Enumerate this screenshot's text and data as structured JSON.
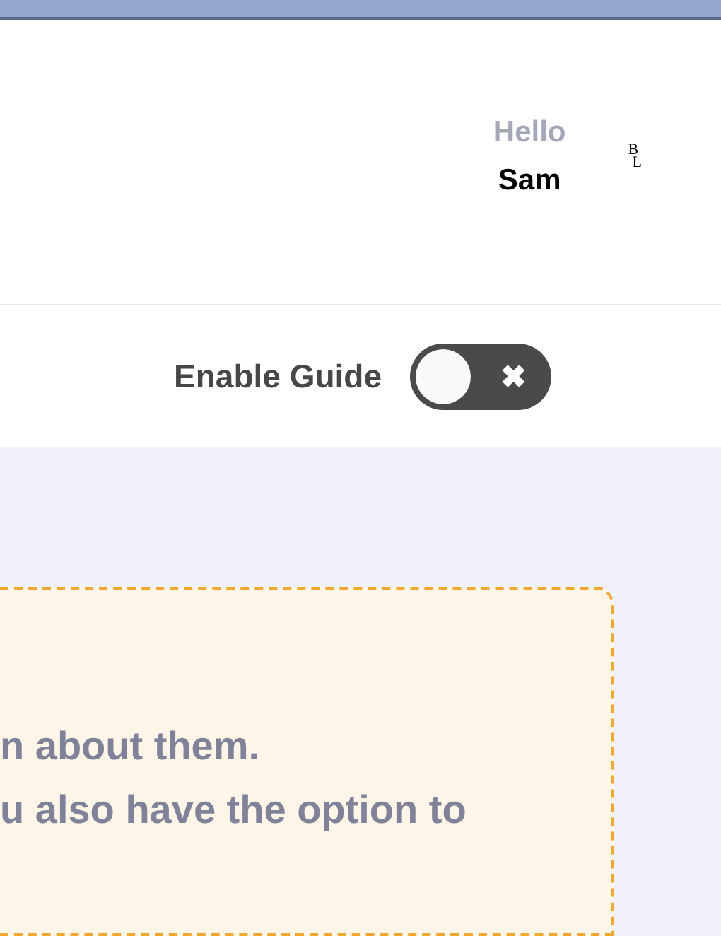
{
  "header": {
    "greeting": "Hello",
    "user_name": "Sam",
    "logo_letters": [
      "B",
      "L"
    ]
  },
  "guide": {
    "label": "Enable Guide",
    "on": false,
    "off_symbol": "✖"
  },
  "card": {
    "lines": [
      "n about them.",
      "u also have the option to"
    ]
  }
}
